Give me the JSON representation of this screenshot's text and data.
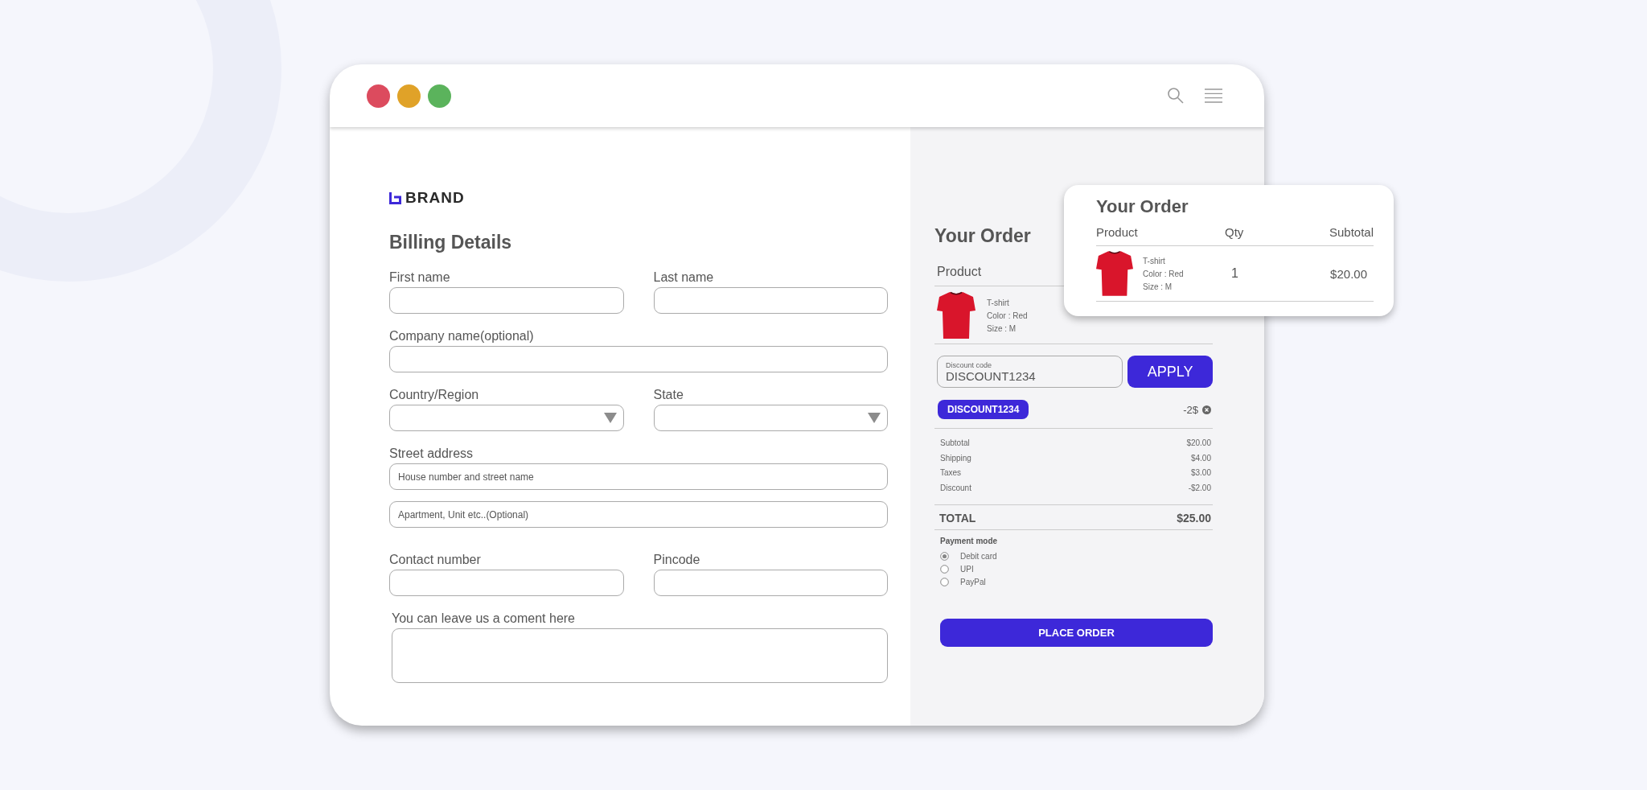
{
  "window": {
    "controls": [
      {
        "color": "#dc4b5e"
      },
      {
        "color": "#e0a228"
      },
      {
        "color": "#5bb35c"
      }
    ]
  },
  "brand": {
    "name": "BRAND"
  },
  "billing": {
    "title": "Billing Details",
    "rows": [
      [
        {
          "label": "First name",
          "kind": "text"
        },
        {
          "label": "Last name",
          "kind": "text"
        }
      ],
      [
        {
          "label": "Company name(optional)",
          "kind": "text"
        }
      ],
      [
        {
          "label": "Country/Region",
          "kind": "select"
        },
        {
          "label": "State",
          "kind": "select"
        }
      ],
      [
        {
          "label": "Street address",
          "kind": "text",
          "placeholders": [
            "House number and street name",
            "Apartment, Unit etc..(Optional)"
          ]
        }
      ],
      [
        {
          "label": "Contact number",
          "kind": "text"
        },
        {
          "label": "Pincode",
          "kind": "text"
        }
      ],
      [
        {
          "label": "You can leave us a coment here",
          "kind": "textarea"
        }
      ]
    ]
  },
  "order": {
    "title": "Your Order",
    "columns": [
      "Product"
    ],
    "items": [
      {
        "name": "T-shirt",
        "details": [
          "Color : Red",
          "Size : M"
        ]
      }
    ],
    "discount": {
      "label": "Discount code",
      "value": "DISCOUNT1234",
      "button": "APPLY",
      "applied_code": "DISCOUNT1234",
      "applied_amount": "-2$"
    },
    "summary": [
      {
        "label": "Subtotal",
        "value": "$20.00"
      },
      {
        "label": "Shipping",
        "value": "$4.00"
      },
      {
        "label": "Taxes",
        "value": "$3.00"
      },
      {
        "label": "Discount",
        "value": "-$2.00"
      }
    ],
    "total": {
      "label": "TOTAL",
      "value": "$25.00"
    },
    "payment": {
      "title": "Payment mode",
      "options": [
        {
          "label": "Debit card",
          "selected": true
        },
        {
          "label": "UPI",
          "selected": false
        },
        {
          "label": "PayPal",
          "selected": false
        }
      ]
    },
    "button": "PLACE ORDER"
  },
  "popup": {
    "title": "Your Order",
    "columns": [
      "Product",
      "Qty",
      "Subtotal"
    ],
    "items": [
      {
        "name": "T-shirt",
        "details": [
          "Color : Red",
          "Size : M"
        ],
        "qty": "1",
        "subtotal": "$20.00"
      }
    ]
  }
}
